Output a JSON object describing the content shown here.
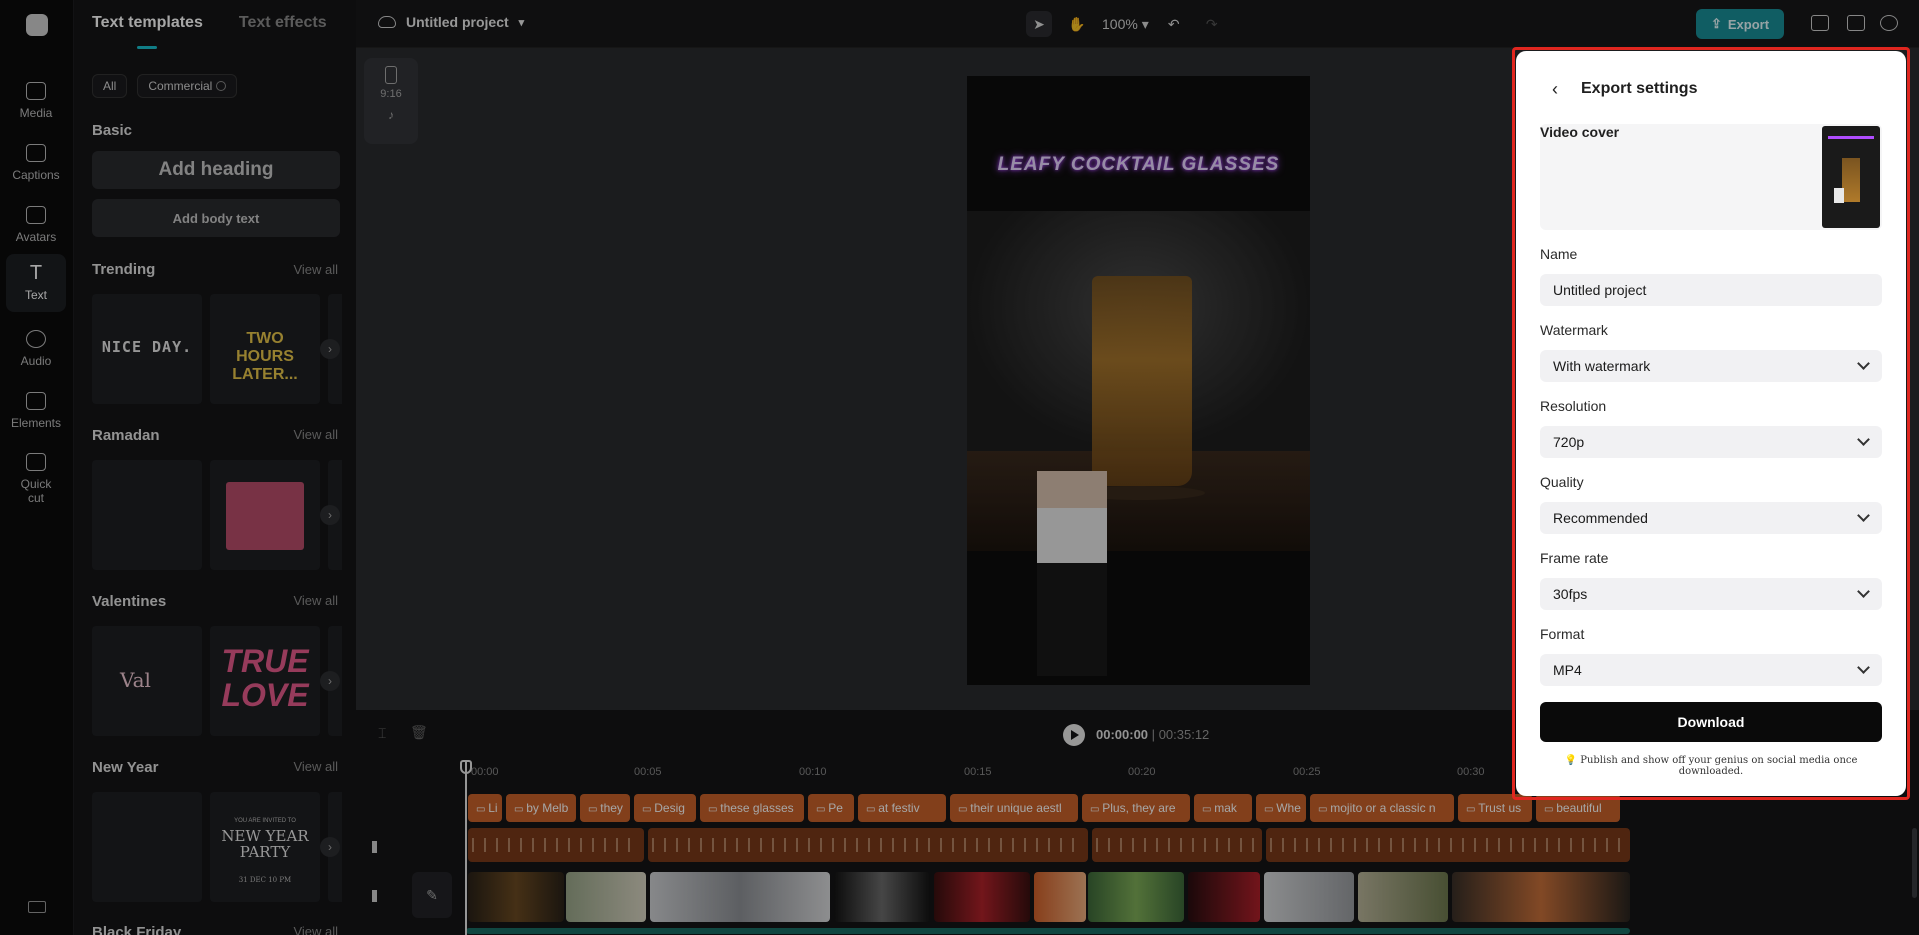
{
  "rail": {
    "items": [
      {
        "label": "Media",
        "icon": "media-icon"
      },
      {
        "label": "Captions",
        "icon": "captions-icon"
      },
      {
        "label": "Avatars",
        "icon": "avatars-icon"
      },
      {
        "label": "Text",
        "icon": "text-icon"
      },
      {
        "label": "Audio",
        "icon": "audio-icon"
      },
      {
        "label": "Elements",
        "icon": "elements-icon"
      },
      {
        "label": "Quick cut",
        "icon": "quick-cut-icon"
      }
    ]
  },
  "panel": {
    "tabs": [
      "Text templates",
      "Text effects"
    ],
    "filters": [
      "All",
      "Commercial"
    ],
    "basic_title": "Basic",
    "add_heading": "Add heading",
    "add_body": "Add body text",
    "view_all": "View all",
    "sections": [
      "Trending",
      "Ramadan",
      "Valentines",
      "New Year",
      "Black Friday"
    ],
    "thumb_texts": {
      "trending_1": "NICE DAY.",
      "trending_2": "TWO HOURS LATER...",
      "valentines_1": "Val",
      "valentines_2": "TRUE LOVE",
      "newyear_2": "NEW YEAR PARTY",
      "newyear_2_small": "YOU ARE INVITED TO",
      "newyear_2_date": "31 DEC 10 PM"
    }
  },
  "topbar": {
    "project_name": "Untitled project",
    "zoom": "100%",
    "export_label": "Export"
  },
  "stage": {
    "ratio": "9:16",
    "video_title": "LEAFY COCKTAIL GLASSES"
  },
  "timeline": {
    "current": "00:00:00",
    "separator": "|",
    "total": "00:35:12",
    "ticks": [
      "00:00",
      "00:05",
      "00:10",
      "00:15",
      "00:20",
      "00:25",
      "00:30"
    ],
    "captions": [
      "Li",
      "by Melb",
      "they",
      "Desig",
      "these glasses",
      "Pe",
      "at festiv",
      "their unique aestl",
      "Plus, they are",
      "mak",
      "Whe",
      "mojito or a classic n",
      "Trust us",
      "beautiful"
    ]
  },
  "export": {
    "title": "Export settings",
    "cover_label": "Video cover",
    "name_label": "Name",
    "name_value": "Untitled project",
    "watermark_label": "Watermark",
    "watermark_value": "With watermark",
    "resolution_label": "Resolution",
    "resolution_value": "720p",
    "quality_label": "Quality",
    "quality_value": "Recommended",
    "framerate_label": "Frame rate",
    "framerate_value": "30fps",
    "format_label": "Format",
    "format_value": "MP4",
    "download_label": "Download",
    "tip": "Publish and show off your genius on social media once downloaded."
  },
  "colors": {
    "accent": "#19c1ce",
    "export_button": "#1a8f99",
    "caption_clip": "#c8622a",
    "highlight": "#e0261f"
  }
}
